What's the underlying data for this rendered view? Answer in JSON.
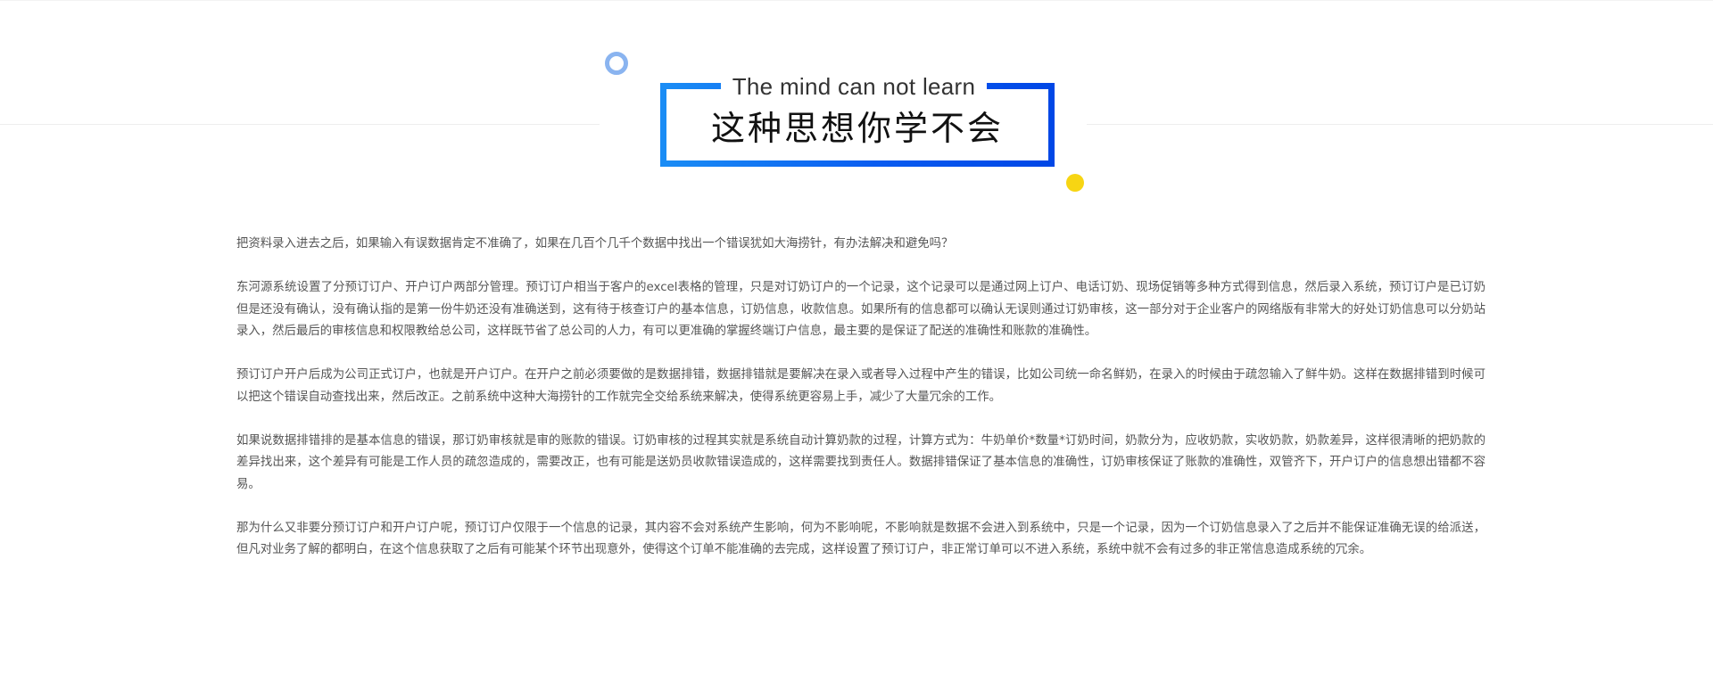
{
  "header": {
    "subtitle_en": "The mind can not learn",
    "title_cn": "这种思想你学不会"
  },
  "colors": {
    "frame_start": "#1a8cf5",
    "frame_end": "#0047e6",
    "ring": "#8ab4f0",
    "dot": "#f7d513",
    "body_text": "#555555"
  },
  "paragraphs": [
    "把资料录入进去之后，如果输入有误数据肯定不准确了，如果在几百个几千个数据中找出一个错误犹如大海捞针，有办法解决和避免吗？",
    "东河源系统设置了分预订订户、开户订户两部分管理。预订订户相当于客户的excel表格的管理，只是对订奶订户的一个记录，这个记录可以是通过网上订户、电话订奶、现场促销等多种方式得到信息，然后录入系统，预订订户是已订奶但是还没有确认，没有确认指的是第一份牛奶还没有准确送到，这有待于核查订户的基本信息，订奶信息，收款信息。如果所有的信息都可以确认无误则通过订奶审核，这一部分对于企业客户的网络版有非常大的好处订奶信息可以分奶站录入，然后最后的审核信息和权限教给总公司，这样既节省了总公司的人力，有可以更准确的掌握终端订户信息，最主要的是保证了配送的准确性和账款的准确性。",
    "预订订户开户后成为公司正式订户，也就是开户订户。在开户之前必须要做的是数据排错，数据排错就是要解决在录入或者导入过程中产生的错误，比如公司统一命名鲜奶，在录入的时候由于疏忽输入了鲜牛奶。这样在数据排错到时候可以把这个错误自动查找出来，然后改正。之前系统中这种大海捞针的工作就完全交给系统来解决，使得系统更容易上手，减少了大量冗余的工作。",
    "如果说数据排错排的是基本信息的错误，那订奶审核就是审的账款的错误。订奶审核的过程其实就是系统自动计算奶款的过程，计算方式为：牛奶单价*数量*订奶时间，奶款分为，应收奶款，实收奶款，奶款差异，这样很清晰的把奶款的差异找出来，这个差异有可能是工作人员的疏忽造成的，需要改正，也有可能是送奶员收款错误造成的，这样需要找到责任人。数据排错保证了基本信息的准确性，订奶审核保证了账款的准确性，双管齐下，开户订户的信息想出错都不容易。",
    "那为什么又非要分预订订户和开户订户呢，预订订户仅限于一个信息的记录，其内容不会对系统产生影响，何为不影响呢，不影响就是数据不会进入到系统中，只是一个记录，因为一个订奶信息录入了之后并不能保证准确无误的给派送，但凡对业务了解的都明白，在这个信息获取了之后有可能某个环节出现意外，使得这个订单不能准确的去完成，这样设置了预订订户，非正常订单可以不进入系统，系统中就不会有过多的非正常信息造成系统的冗余。"
  ]
}
